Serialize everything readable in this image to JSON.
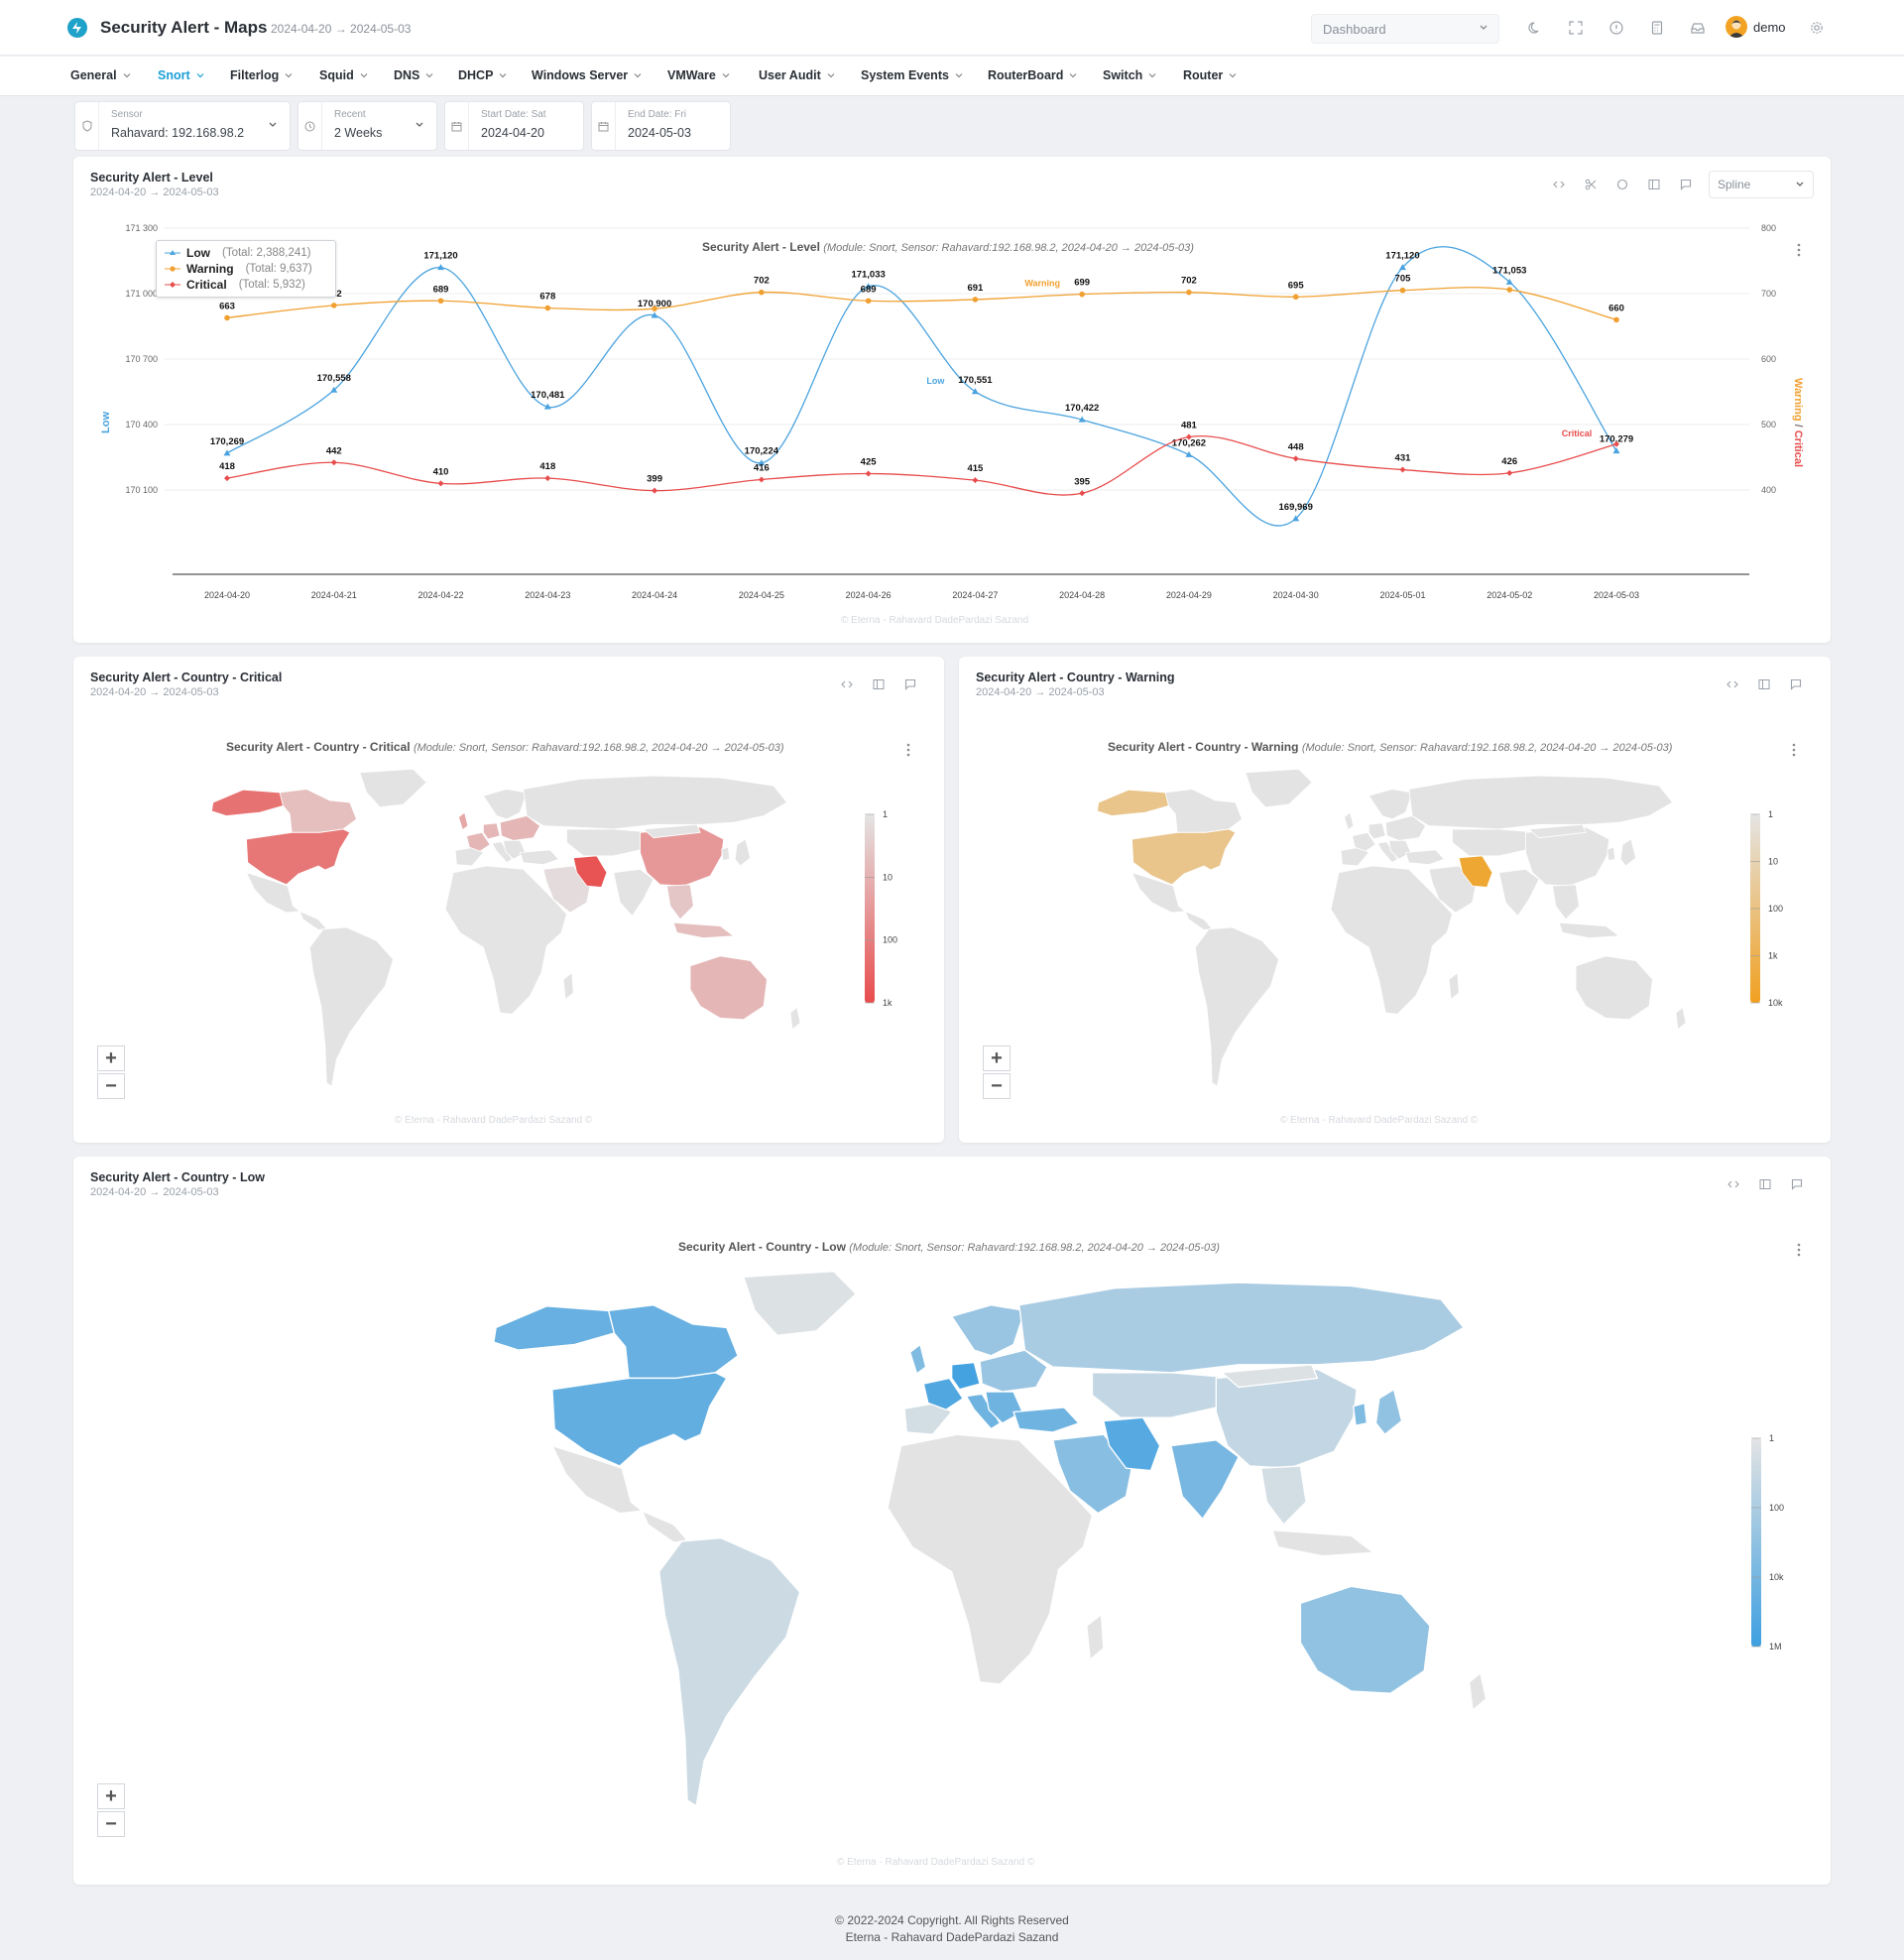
{
  "header": {
    "title": "Security Alert - Maps",
    "range": "2024-04-20 → 2024-05-03",
    "dashboard_placeholder": "Dashboard",
    "user": "demo",
    "icons": [
      "moon-icon",
      "fullscreen-icon",
      "info-icon",
      "calculator-icon",
      "inbox-icon"
    ]
  },
  "nav": [
    {
      "label": "General"
    },
    {
      "label": "Snort",
      "active": true
    },
    {
      "label": "Filterlog"
    },
    {
      "label": "Squid"
    },
    {
      "label": "DNS"
    },
    {
      "label": "DHCP"
    },
    {
      "label": "Windows Server"
    },
    {
      "label": "VMWare"
    },
    {
      "label": "User Audit"
    },
    {
      "label": "System Events"
    },
    {
      "label": "RouterBoard"
    },
    {
      "label": "Switch"
    },
    {
      "label": "Router"
    }
  ],
  "filters": {
    "sensor": {
      "label": "Sensor",
      "value": "Rahavard: 192.168.98.2"
    },
    "recent": {
      "label": "Recent",
      "value": "2 Weeks"
    },
    "start": {
      "label": "Start Date: Sat",
      "value": "2024-04-20"
    },
    "end": {
      "label": "End Date: Fri",
      "value": "2024-05-03"
    }
  },
  "level_card": {
    "title": "Security Alert - Level",
    "subtitle": "2024-04-20 → 2024-05-03",
    "chart_type_select": "Spline",
    "chart_title": "Security Alert - Level",
    "chart_subtitle": "(Module: Snort, Sensor: Rahavard:192.168.98.2, 2024-04-20 → 2024-05-03)",
    "watermark": "© Eterna - Rahavard DadePardazi Sazand"
  },
  "chart_data": {
    "type": "line",
    "x": [
      "2024-04-20",
      "2024-04-21",
      "2024-04-22",
      "2024-04-23",
      "2024-04-24",
      "2024-04-25",
      "2024-04-26",
      "2024-04-27",
      "2024-04-28",
      "2024-04-29",
      "2024-04-30",
      "2024-05-01",
      "2024-05-02",
      "2024-05-03"
    ],
    "left_axis": {
      "label": "Low",
      "ticks": [
        170100,
        170400,
        170700,
        171000,
        171300
      ],
      "tick_labels": [
        "170 100",
        "170 400",
        "170 700",
        "171 000",
        "171 300"
      ],
      "ylim": [
        169800,
        171300
      ]
    },
    "right_axis": {
      "label_a": "Warning",
      "label_sep": " / ",
      "label_b": "Critical",
      "ticks": [
        400,
        500,
        600,
        700,
        800
      ],
      "ylim": [
        300,
        800
      ]
    },
    "series": [
      {
        "name": "Low",
        "axis": "left",
        "color": "#4aa3df",
        "total": "(Total: 2,388,241)",
        "values": [
          170269,
          170558,
          171120,
          170481,
          170900,
          170224,
          171033,
          170551,
          170422,
          170262,
          169969,
          171120,
          171053,
          170279
        ],
        "labels": [
          "170,269",
          "170,558",
          "171,120",
          "170,481",
          "170,900",
          "170,224",
          "171,033",
          "170,551",
          "170,422",
          "170,262",
          "169,969",
          "171,120",
          "171,053",
          "170,279"
        ]
      },
      {
        "name": "Warning",
        "axis": "right",
        "color": "#f0a030",
        "total": "(Total: 9,637)",
        "values": [
          663,
          682,
          689,
          678,
          677,
          702,
          689,
          691,
          699,
          702,
          695,
          705,
          706,
          660
        ],
        "labels": [
          "663",
          "682",
          "689",
          "678",
          "",
          "702",
          "689",
          "691",
          "699",
          "702",
          "695",
          "705",
          "",
          "660"
        ]
      },
      {
        "name": "Critical",
        "axis": "right",
        "color": "#e84c4c",
        "total": "(Total: 5,932)",
        "values": [
          418,
          442,
          410,
          418,
          399,
          416,
          425,
          415,
          395,
          481,
          448,
          431,
          426,
          470
        ],
        "labels": [
          "418",
          "442",
          "410",
          "418",
          "399",
          "416",
          "425",
          "415",
          "395",
          "481",
          "448",
          "431",
          "426",
          ""
        ]
      }
    ],
    "annotations": [
      {
        "text": "Warning",
        "series": "Warning",
        "at": "2024-04-28"
      },
      {
        "text": "Low",
        "series": "Low",
        "at": "2024-04-27"
      },
      {
        "text": "Critical",
        "series": "Critical",
        "at": "2024-05-03"
      }
    ],
    "grid": true,
    "legend": "top-left"
  },
  "maps": [
    {
      "title": "Security Alert - Country - Critical",
      "subtitle": "2024-04-20 → 2024-05-03",
      "chart_title": "Security Alert - Country - Critical",
      "chart_subtitle": "(Module: Snort, Sensor: Rahavard:192.168.98.2, 2024-04-20 → 2024-05-03)",
      "scale": [
        "1",
        "10",
        "100",
        "1k"
      ],
      "colors": [
        "#e4e4e4",
        "#e84c4c"
      ],
      "watermark": "© Eterna - Rahavard DadePardazi Sazand ©"
    },
    {
      "title": "Security Alert - Country - Warning",
      "subtitle": "2024-04-20 → 2024-05-03",
      "chart_title": "Security Alert - Country - Warning",
      "chart_subtitle": "(Module: Snort, Sensor: Rahavard:192.168.98.2, 2024-04-20 → 2024-05-03)",
      "scale": [
        "1",
        "10",
        "100",
        "1k",
        "10k"
      ],
      "colors": [
        "#e4e4e4",
        "#f0a020"
      ],
      "watermark": "© Eterna - Rahavard DadePardazi Sazand ©"
    },
    {
      "title": "Security Alert - Country - Low",
      "subtitle": "2024-04-20 → 2024-05-03",
      "chart_title": "Security Alert - Country - Low",
      "chart_subtitle": "(Module: Snort, Sensor: Rahavard:192.168.98.2, 2024-04-20 → 2024-05-03)",
      "scale": [
        "1",
        "100",
        "10k",
        "1M"
      ],
      "colors": [
        "#e4e4e4",
        "#3d9fe0"
      ],
      "watermark": "© Eterna - Rahavard DadePardazi Sazand ©"
    }
  ],
  "footer": {
    "line1": "© 2022-2024 Copyright. All Rights Reserved",
    "line2": "Eterna - Rahavard DadePardazi Sazand"
  }
}
